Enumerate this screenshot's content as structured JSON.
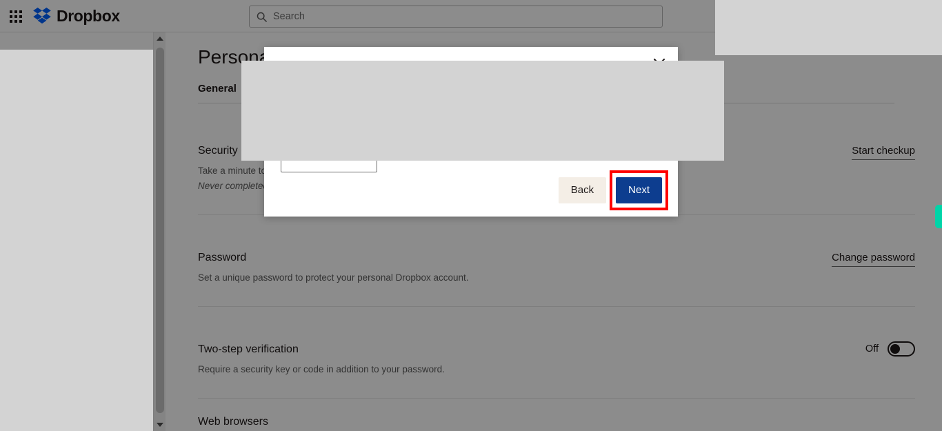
{
  "topbar": {
    "apps_grid_icon": "grid-apps-icon",
    "brand_name": "Dropbox",
    "brand_logo_icon": "dropbox-logo-icon",
    "brand_color": "#0061fe",
    "search": {
      "icon": "search-icon",
      "placeholder": "Search",
      "value": ""
    }
  },
  "page": {
    "title": "Personal",
    "tabs": [
      {
        "label": "General",
        "active": true
      }
    ],
    "sections": [
      {
        "id": "security-checkup",
        "title": "Security c",
        "description": "Take a minute to",
        "note": "Never completed",
        "action_label": "Start checkup"
      },
      {
        "id": "password",
        "title": "Password",
        "description": "Set a unique password to protect your personal Dropbox account.",
        "action_label": "Change password"
      },
      {
        "id": "two-step-verification",
        "title": "Two-step verification",
        "description": "Require a security key or code in addition to your password.",
        "toggle_label": "Off",
        "toggle_state": "off"
      },
      {
        "id": "web-browsers",
        "title": "Web browsers"
      }
    ]
  },
  "scrollbar": {
    "up_arrow_icon": "chevron-up-icon",
    "down_arrow_icon": "chevron-down-icon",
    "orientation": "vertical"
  },
  "feedback_tab": {
    "name": "feedback-tab",
    "color": "#00d4a8"
  },
  "modal": {
    "close_icon": "close-x-icon",
    "buttons": {
      "back_label": "Back",
      "next_label": "Next"
    },
    "next_button_color": "#0d3d8f",
    "back_button_color": "#f4eee6",
    "highlight_color": "#ff0000",
    "input_value": ""
  }
}
